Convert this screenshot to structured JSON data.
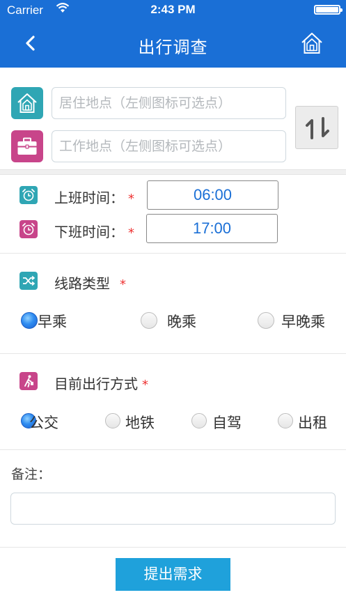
{
  "status_bar": {
    "carrier": "Carrier",
    "time": "2:43 PM"
  },
  "header": {
    "title": "出行调查"
  },
  "locations": {
    "home_placeholder": "居住地点（左侧图标可选点）",
    "work_placeholder": "工作地点（左侧图标可选点）",
    "home_value": "",
    "work_value": ""
  },
  "times": {
    "start_label": "上班时间：",
    "start_value": "06:00",
    "end_label": "下班时间：",
    "end_value": "17:00",
    "required_mark": "*"
  },
  "route_type": {
    "label": "线路类型",
    "required_mark": "*",
    "options": [
      "早乘",
      "晚乘",
      "早晚乘"
    ],
    "selected": "早乘"
  },
  "travel_mode": {
    "label": "目前出行方式",
    "required_mark": "*",
    "options": [
      "公交",
      "地铁",
      "自驾",
      "出租"
    ],
    "selected": "公交"
  },
  "remark": {
    "label": "备注：",
    "value": ""
  },
  "submit": {
    "label": "提出需求"
  },
  "colors": {
    "header_bg": "#1a6fd6",
    "home_icon_bg": "#2fa6b4",
    "work_icon_bg": "#c8458a",
    "time_value": "#1a6fd6",
    "required": "#e33333",
    "submit_bg": "#1fa1db"
  },
  "icons": {
    "back": "chevron-left-icon",
    "home_nav": "home-icon",
    "home_location": "house-icon",
    "work_location": "briefcase-icon",
    "swap": "swap-vertical-icon",
    "start_alarm": "alarm-clock-icon",
    "end_alarm": "alarm-clock-icon",
    "route": "shuffle-icon",
    "travel": "walking-person-icon"
  }
}
